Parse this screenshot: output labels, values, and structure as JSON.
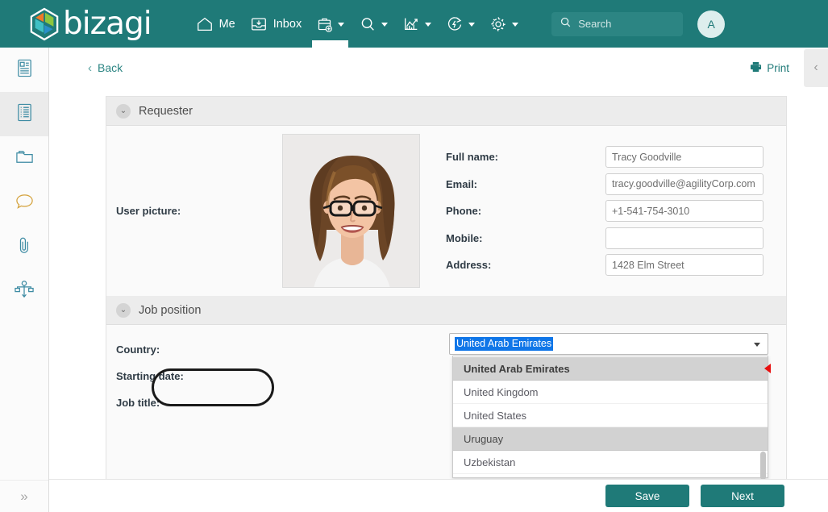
{
  "header": {
    "brand": "bizagi",
    "nav": [
      {
        "label": "Me",
        "icon": "home-icon",
        "caret": false,
        "active": false
      },
      {
        "label": "Inbox",
        "icon": "inbox-icon",
        "caret": false,
        "active": false
      },
      {
        "label": "",
        "icon": "new-case-icon",
        "caret": true,
        "active": true
      },
      {
        "label": "",
        "icon": "search-icon",
        "caret": true,
        "active": false
      },
      {
        "label": "",
        "icon": "analytics-icon",
        "caret": true,
        "active": false
      },
      {
        "label": "",
        "icon": "refresh-icon",
        "caret": true,
        "active": false
      },
      {
        "label": "",
        "icon": "gear-icon",
        "caret": true,
        "active": false
      }
    ],
    "search_placeholder": "Search",
    "avatar_initial": "A",
    "accent_color": "#1f7a78"
  },
  "rail": {
    "items": [
      {
        "icon": "case-summary-icon",
        "selected": false
      },
      {
        "icon": "form-list-icon",
        "selected": true
      },
      {
        "icon": "folder-icon",
        "selected": false
      },
      {
        "icon": "comment-icon",
        "selected": false
      },
      {
        "icon": "attachment-icon",
        "selected": false
      },
      {
        "icon": "process-flow-icon",
        "selected": false
      }
    ],
    "expand_glyph": "»"
  },
  "toolbar": {
    "back_label": "Back",
    "back_chevron": "‹",
    "print_label": "Print",
    "panel_toggle_glyph": "‹"
  },
  "sections": [
    {
      "id": "requester",
      "title": "Requester",
      "twisty": "⌄",
      "picture_label": "User picture:",
      "fields": [
        {
          "label": "Full name:",
          "value": "Tracy Goodville"
        },
        {
          "label": "Email:",
          "value": "tracy.goodville@agilityCorp.com"
        },
        {
          "label": "Phone:",
          "value": "+1-541-754-3010"
        },
        {
          "label": "Mobile:",
          "value": ""
        },
        {
          "label": "Address:",
          "value": "1428 Elm Street"
        }
      ]
    },
    {
      "id": "job-position",
      "title": "Job position",
      "twisty": "⌄",
      "rows": [
        {
          "label": "Country:"
        },
        {
          "label": "Starting date:"
        },
        {
          "label": "Job title:"
        }
      ]
    }
  ],
  "country_combo": {
    "selected_value": "United Arab Emirates",
    "options": [
      {
        "label": "United Arab Emirates",
        "highlighted": true,
        "alt": false
      },
      {
        "label": "United Kingdom",
        "highlighted": false,
        "alt": false
      },
      {
        "label": "United States",
        "highlighted": false,
        "alt": false
      },
      {
        "label": "Uruguay",
        "highlighted": false,
        "alt": true
      },
      {
        "label": "Uzbekistan",
        "highlighted": false,
        "alt": false
      }
    ],
    "selection_highlight_color": "#1076e8",
    "cursor_marker_color": "#e81010"
  },
  "footer": {
    "save_label": "Save",
    "next_label": "Next"
  }
}
